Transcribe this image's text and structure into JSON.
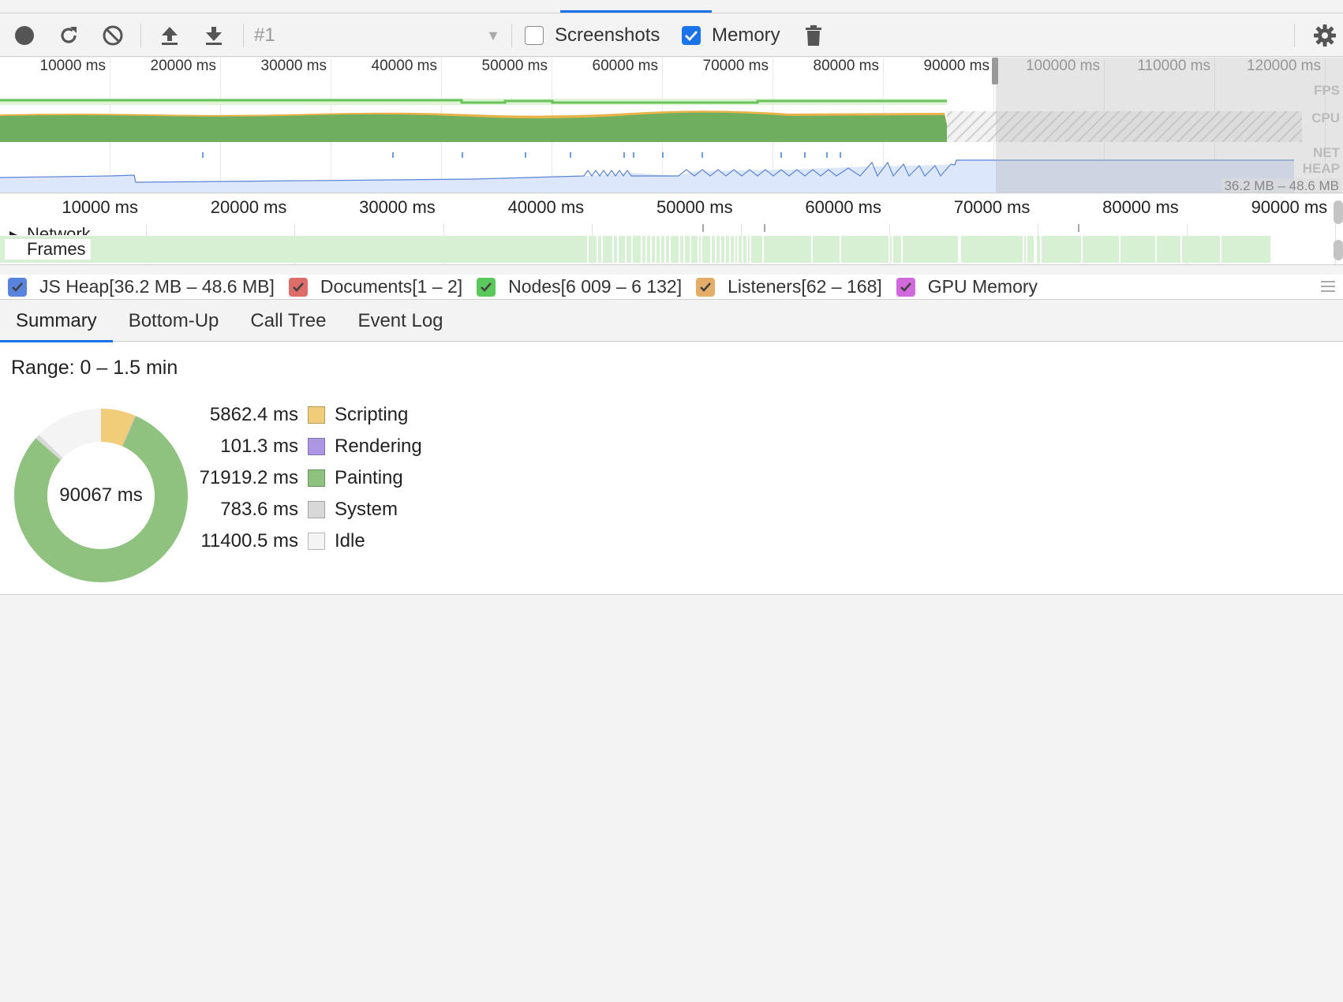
{
  "toolbar": {
    "profile_selector_value": "#1",
    "screenshots_label": "Screenshots",
    "screenshots_checked": false,
    "memory_label": "Memory",
    "memory_checked": true
  },
  "overview": {
    "ticks": [
      "10000 ms",
      "20000 ms",
      "30000 ms",
      "40000 ms",
      "50000 ms",
      "60000 ms",
      "70000 ms",
      "80000 ms",
      "90000 ms",
      "100000 ms",
      "110000 ms",
      "120000 ms"
    ],
    "lane_labels": {
      "fps": "FPS",
      "cpu": "CPU",
      "net": "NET",
      "heap": "HEAP"
    },
    "heap_range": "36.2 MB – 48.6 MB"
  },
  "timeline": {
    "ticks": [
      "10000 ms",
      "20000 ms",
      "30000 ms",
      "40000 ms",
      "50000 ms",
      "60000 ms",
      "70000 ms",
      "80000 ms",
      "90000 ms"
    ],
    "network_label": "Network",
    "frames_label": "Frames"
  },
  "counters": [
    {
      "label": "JS Heap[36.2 MB – 48.6 MB]",
      "color": "#3b6fd8",
      "checked": true
    },
    {
      "label": "Documents[1 – 2]",
      "color": "#d9534f",
      "checked": true
    },
    {
      "label": "Nodes[6 009 – 6 132]",
      "color": "#3fbf3f",
      "checked": true
    },
    {
      "label": "Listeners[62 – 168]",
      "color": "#e0a050",
      "checked": true
    },
    {
      "label": "GPU Memory",
      "color": "#c94fd6",
      "checked": true
    }
  ],
  "tabs": [
    {
      "label": "Summary",
      "active": true
    },
    {
      "label": "Bottom-Up",
      "active": false
    },
    {
      "label": "Call Tree",
      "active": false
    },
    {
      "label": "Event Log",
      "active": false
    }
  ],
  "summary": {
    "range": "Range: 0 – 1.5 min",
    "total": "90067 ms",
    "items": [
      {
        "value": "5862.4 ms",
        "label": "Scripting",
        "color": "#f2cd79",
        "ms": 5862.4
      },
      {
        "value": "101.3 ms",
        "label": "Rendering",
        "color": "#ab97e4",
        "ms": 101.3
      },
      {
        "value": "71919.2 ms",
        "label": "Painting",
        "color": "#8fc17f",
        "ms": 71919.2
      },
      {
        "value": "783.6 ms",
        "label": "System",
        "color": "#d8d8d8",
        "ms": 783.6
      },
      {
        "value": "11400.5 ms",
        "label": "Idle",
        "color": "#f4f4f4",
        "ms": 11400.5
      }
    ]
  }
}
